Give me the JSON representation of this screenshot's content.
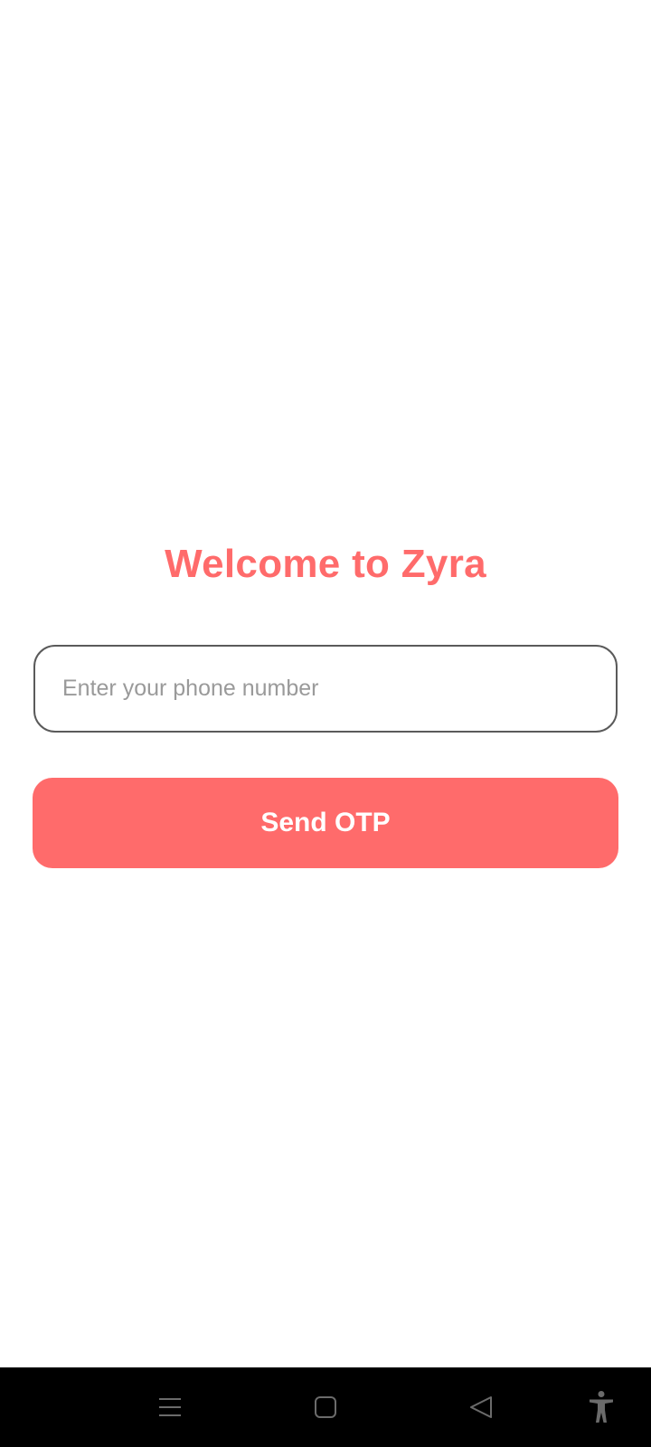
{
  "login": {
    "title": "Welcome to Zyra",
    "phone_placeholder": "Enter your phone number",
    "phone_value": "",
    "send_otp_label": "Send OTP"
  },
  "nav_bar": {
    "buttons": [
      {
        "icon": "menu-icon"
      },
      {
        "icon": "home-square-icon"
      },
      {
        "icon": "back-triangle-icon"
      },
      {
        "icon": "accessibility-icon"
      }
    ]
  },
  "colors": {
    "accent": "#ff6b6b",
    "input_border": "#5a5a5a",
    "placeholder": "#9a9a9a",
    "nav_background": "#000000",
    "nav_icon": "#6b6b6b"
  }
}
